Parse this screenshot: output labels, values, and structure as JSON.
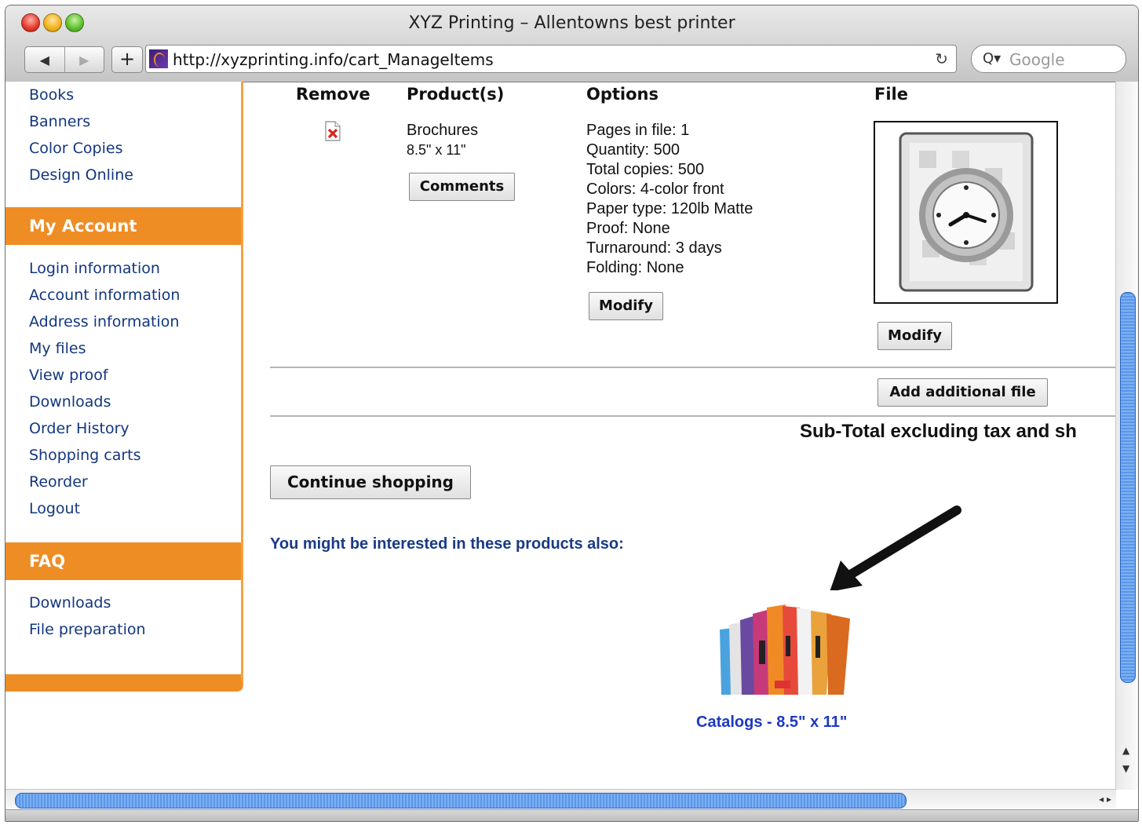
{
  "window": {
    "title": "XYZ Printing – Allentowns best printer"
  },
  "toolbar": {
    "back_icon": "◀",
    "forward_icon": "▶",
    "add_icon": "+",
    "url": "http://xyzprinting.info/cart_ManageItems",
    "reload_icon": "↻",
    "search_glyph": "Q▾",
    "search_placeholder": "Google"
  },
  "sidebar": {
    "top_links": [
      "Books",
      "Banners",
      "Color Copies",
      "Design Online"
    ],
    "my_account": {
      "title": "My Account",
      "links": [
        "Login information",
        "Account information",
        "Address information",
        "My files",
        "View proof",
        "Downloads",
        "Order History",
        "Shopping carts",
        "Reorder",
        "Logout"
      ]
    },
    "faq": {
      "title": "FAQ",
      "links": [
        "Downloads",
        "File preparation"
      ]
    }
  },
  "cart": {
    "columns": {
      "remove": "Remove",
      "products": "Product(s)",
      "options": "Options",
      "file": "File"
    },
    "item": {
      "product_name": "Brochures",
      "product_size": "8.5\" x 11\"",
      "comments_label": "Comments",
      "options": [
        "Pages in file: 1",
        "Quantity: 500",
        "Total copies: 500",
        "Colors: 4-color front",
        "Paper type: 120lb Matte",
        "Proof: None",
        "Turnaround: 3 days",
        "Folding: None"
      ],
      "modify_options_label": "Modify",
      "modify_file_label": "Modify"
    },
    "add_file_label": "Add additional file",
    "subtotal_label": "Sub-Total  excluding tax and sh"
  },
  "continue_label": "Continue shopping",
  "recommend": {
    "heading": "You might be interested in these products also:",
    "product_label": "Catalogs - 8.5\" x 11\""
  },
  "scroll": {
    "up_arrow": "▲",
    "down_arrow": "▼",
    "h_arrows": "◂ ▸"
  },
  "colors": {
    "sidebar_orange": "#ef8d25",
    "link_blue": "#12367f",
    "product_link": "#1d38c4"
  }
}
